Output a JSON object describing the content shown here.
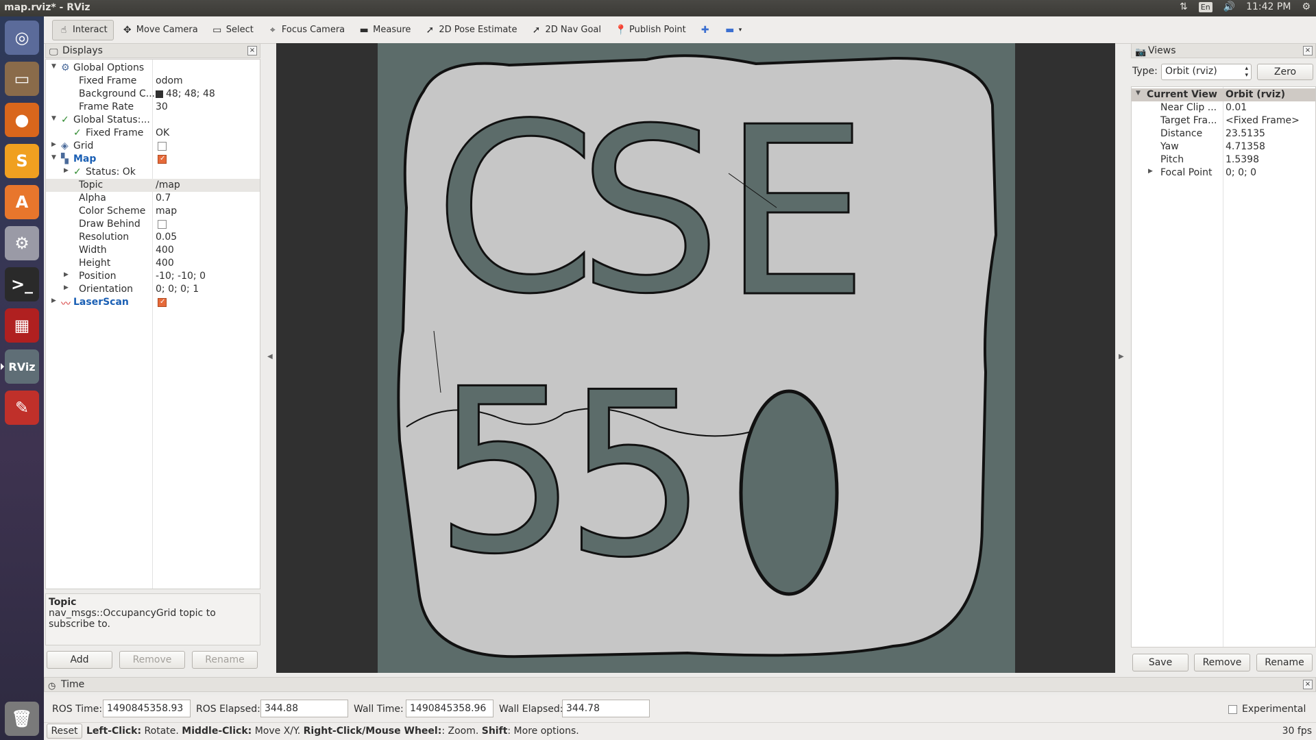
{
  "window": {
    "title": "map.rviz* - RViz"
  },
  "tray": {
    "lang": "En",
    "time": "11:42 PM"
  },
  "launcher": {
    "items": [
      {
        "name": "dash-icon",
        "glyph": "◎",
        "color": "#5b6b9a"
      },
      {
        "name": "files-icon",
        "glyph": "▭",
        "color": "#8a6b4a"
      },
      {
        "name": "firefox-icon",
        "glyph": "●",
        "color": "#d9661c"
      },
      {
        "name": "sublime-icon",
        "glyph": "S",
        "color": "#f0a020"
      },
      {
        "name": "software-center-icon",
        "glyph": "A",
        "color": "#e8762c"
      },
      {
        "name": "settings-icon",
        "glyph": "⚙",
        "color": "#9a9aa6"
      },
      {
        "name": "terminal-icon",
        "glyph": ">_",
        "color": "#2a2a2a"
      },
      {
        "name": "app-red-icon",
        "glyph": "▦",
        "color": "#b02020"
      },
      {
        "name": "rviz-icon",
        "glyph": "RViz",
        "color": "#5f6e76"
      },
      {
        "name": "texteditor-icon",
        "glyph": "✎",
        "color": "#c0302a"
      },
      {
        "name": "trash-icon",
        "glyph": "🗑",
        "color": "#7a7a7a"
      }
    ]
  },
  "toolbar": {
    "tools": [
      {
        "label": "Interact",
        "icon": "☝",
        "name": "interact-tool",
        "active": true
      },
      {
        "label": "Move Camera",
        "icon": "✥",
        "name": "move-camera-tool"
      },
      {
        "label": "Select",
        "icon": "▭",
        "name": "select-tool"
      },
      {
        "label": "Focus Camera",
        "icon": "⌖",
        "name": "focus-camera-tool"
      },
      {
        "label": "Measure",
        "icon": "▬",
        "name": "measure-tool"
      },
      {
        "label": "2D Pose Estimate",
        "icon": "➚",
        "name": "pose-estimate-tool"
      },
      {
        "label": "2D Nav Goal",
        "icon": "➚",
        "name": "nav-goal-tool"
      },
      {
        "label": "Publish Point",
        "icon": "📍",
        "name": "publish-point-tool"
      }
    ]
  },
  "displays": {
    "title": "Displays",
    "rows": [
      {
        "indent": 0,
        "arrow": "▼",
        "icon": "⚙",
        "name": "Global Options",
        "value": ""
      },
      {
        "indent": 1,
        "name": "Fixed Frame",
        "value": "odom"
      },
      {
        "indent": 1,
        "name": "Background C...",
        "value": "48; 48; 48",
        "swatch": "#303030"
      },
      {
        "indent": 1,
        "name": "Frame Rate",
        "value": "30"
      },
      {
        "indent": 0,
        "arrow": "▼",
        "icon": "✓",
        "name": "Global Status:...",
        "value": ""
      },
      {
        "indent": 1,
        "icon": "✓",
        "name": "Fixed Frame",
        "value": "OK"
      },
      {
        "indent": 0,
        "arrow": "▶",
        "icon": "◈",
        "name": "Grid",
        "value": "",
        "check": false
      },
      {
        "indent": 0,
        "arrow": "▼",
        "icon": "▚",
        "name": "Map",
        "value": "",
        "check": true,
        "blue": true
      },
      {
        "indent": 1,
        "arrow": "▶",
        "icon": "✓",
        "name": "Status: Ok",
        "value": ""
      },
      {
        "indent": 1,
        "name": "Topic",
        "value": "/map",
        "hl": true
      },
      {
        "indent": 1,
        "name": "Alpha",
        "value": "0.7"
      },
      {
        "indent": 1,
        "name": "Color Scheme",
        "value": "map"
      },
      {
        "indent": 1,
        "name": "Draw Behind",
        "value": "",
        "check": false
      },
      {
        "indent": 1,
        "name": "Resolution",
        "value": "0.05"
      },
      {
        "indent": 1,
        "name": "Width",
        "value": "400"
      },
      {
        "indent": 1,
        "name": "Height",
        "value": "400"
      },
      {
        "indent": 1,
        "arrow": "▶",
        "name": "Position",
        "value": "-10; -10; 0"
      },
      {
        "indent": 1,
        "arrow": "▶",
        "name": "Orientation",
        "value": "0; 0; 0; 1"
      },
      {
        "indent": 0,
        "arrow": "▶",
        "icon": "〰",
        "name": "LaserScan",
        "value": "",
        "check": true,
        "blue": true
      }
    ],
    "desc_title": "Topic",
    "desc_text": "nav_msgs::OccupancyGrid topic to subscribe to.",
    "buttons": {
      "add": "Add",
      "remove": "Remove",
      "rename": "Rename"
    }
  },
  "map": {
    "letters": [
      "C",
      "S",
      "E",
      "5",
      "5",
      "0"
    ]
  },
  "views": {
    "title": "Views",
    "type_label": "Type:",
    "type_value": "Orbit (rviz)",
    "zero": "Zero",
    "header": {
      "name": "Current View",
      "value": "Orbit (rviz)"
    },
    "rows": [
      {
        "name": "Near Clip ...",
        "value": "0.01"
      },
      {
        "name": "Target Fra...",
        "value": "<Fixed Frame>"
      },
      {
        "name": "Distance",
        "value": "23.5135"
      },
      {
        "name": "Yaw",
        "value": "4.71358"
      },
      {
        "name": "Pitch",
        "value": "1.5398"
      },
      {
        "name": "Focal Point",
        "value": "0; 0; 0",
        "arrow": "▶"
      }
    ],
    "buttons": {
      "save": "Save",
      "remove": "Remove",
      "rename": "Rename"
    }
  },
  "time": {
    "title": "Time",
    "ros_time_label": "ROS Time:",
    "ros_time": "1490845358.93",
    "ros_elapsed_label": "ROS Elapsed:",
    "ros_elapsed": "344.88",
    "wall_time_label": "Wall Time:",
    "wall_time": "1490845358.96",
    "wall_elapsed_label": "Wall Elapsed:",
    "wall_elapsed": "344.78",
    "experimental": "Experimental"
  },
  "status": {
    "reset": "Reset",
    "k1": "Left-Click:",
    "v1": " Rotate. ",
    "k2": "Middle-Click:",
    "v2": " Move X/Y. ",
    "k3": "Right-Click/Mouse Wheel:",
    "v3": ": Zoom. ",
    "k4": "Shift",
    "v4": ": More options.",
    "fps": "30 fps"
  }
}
